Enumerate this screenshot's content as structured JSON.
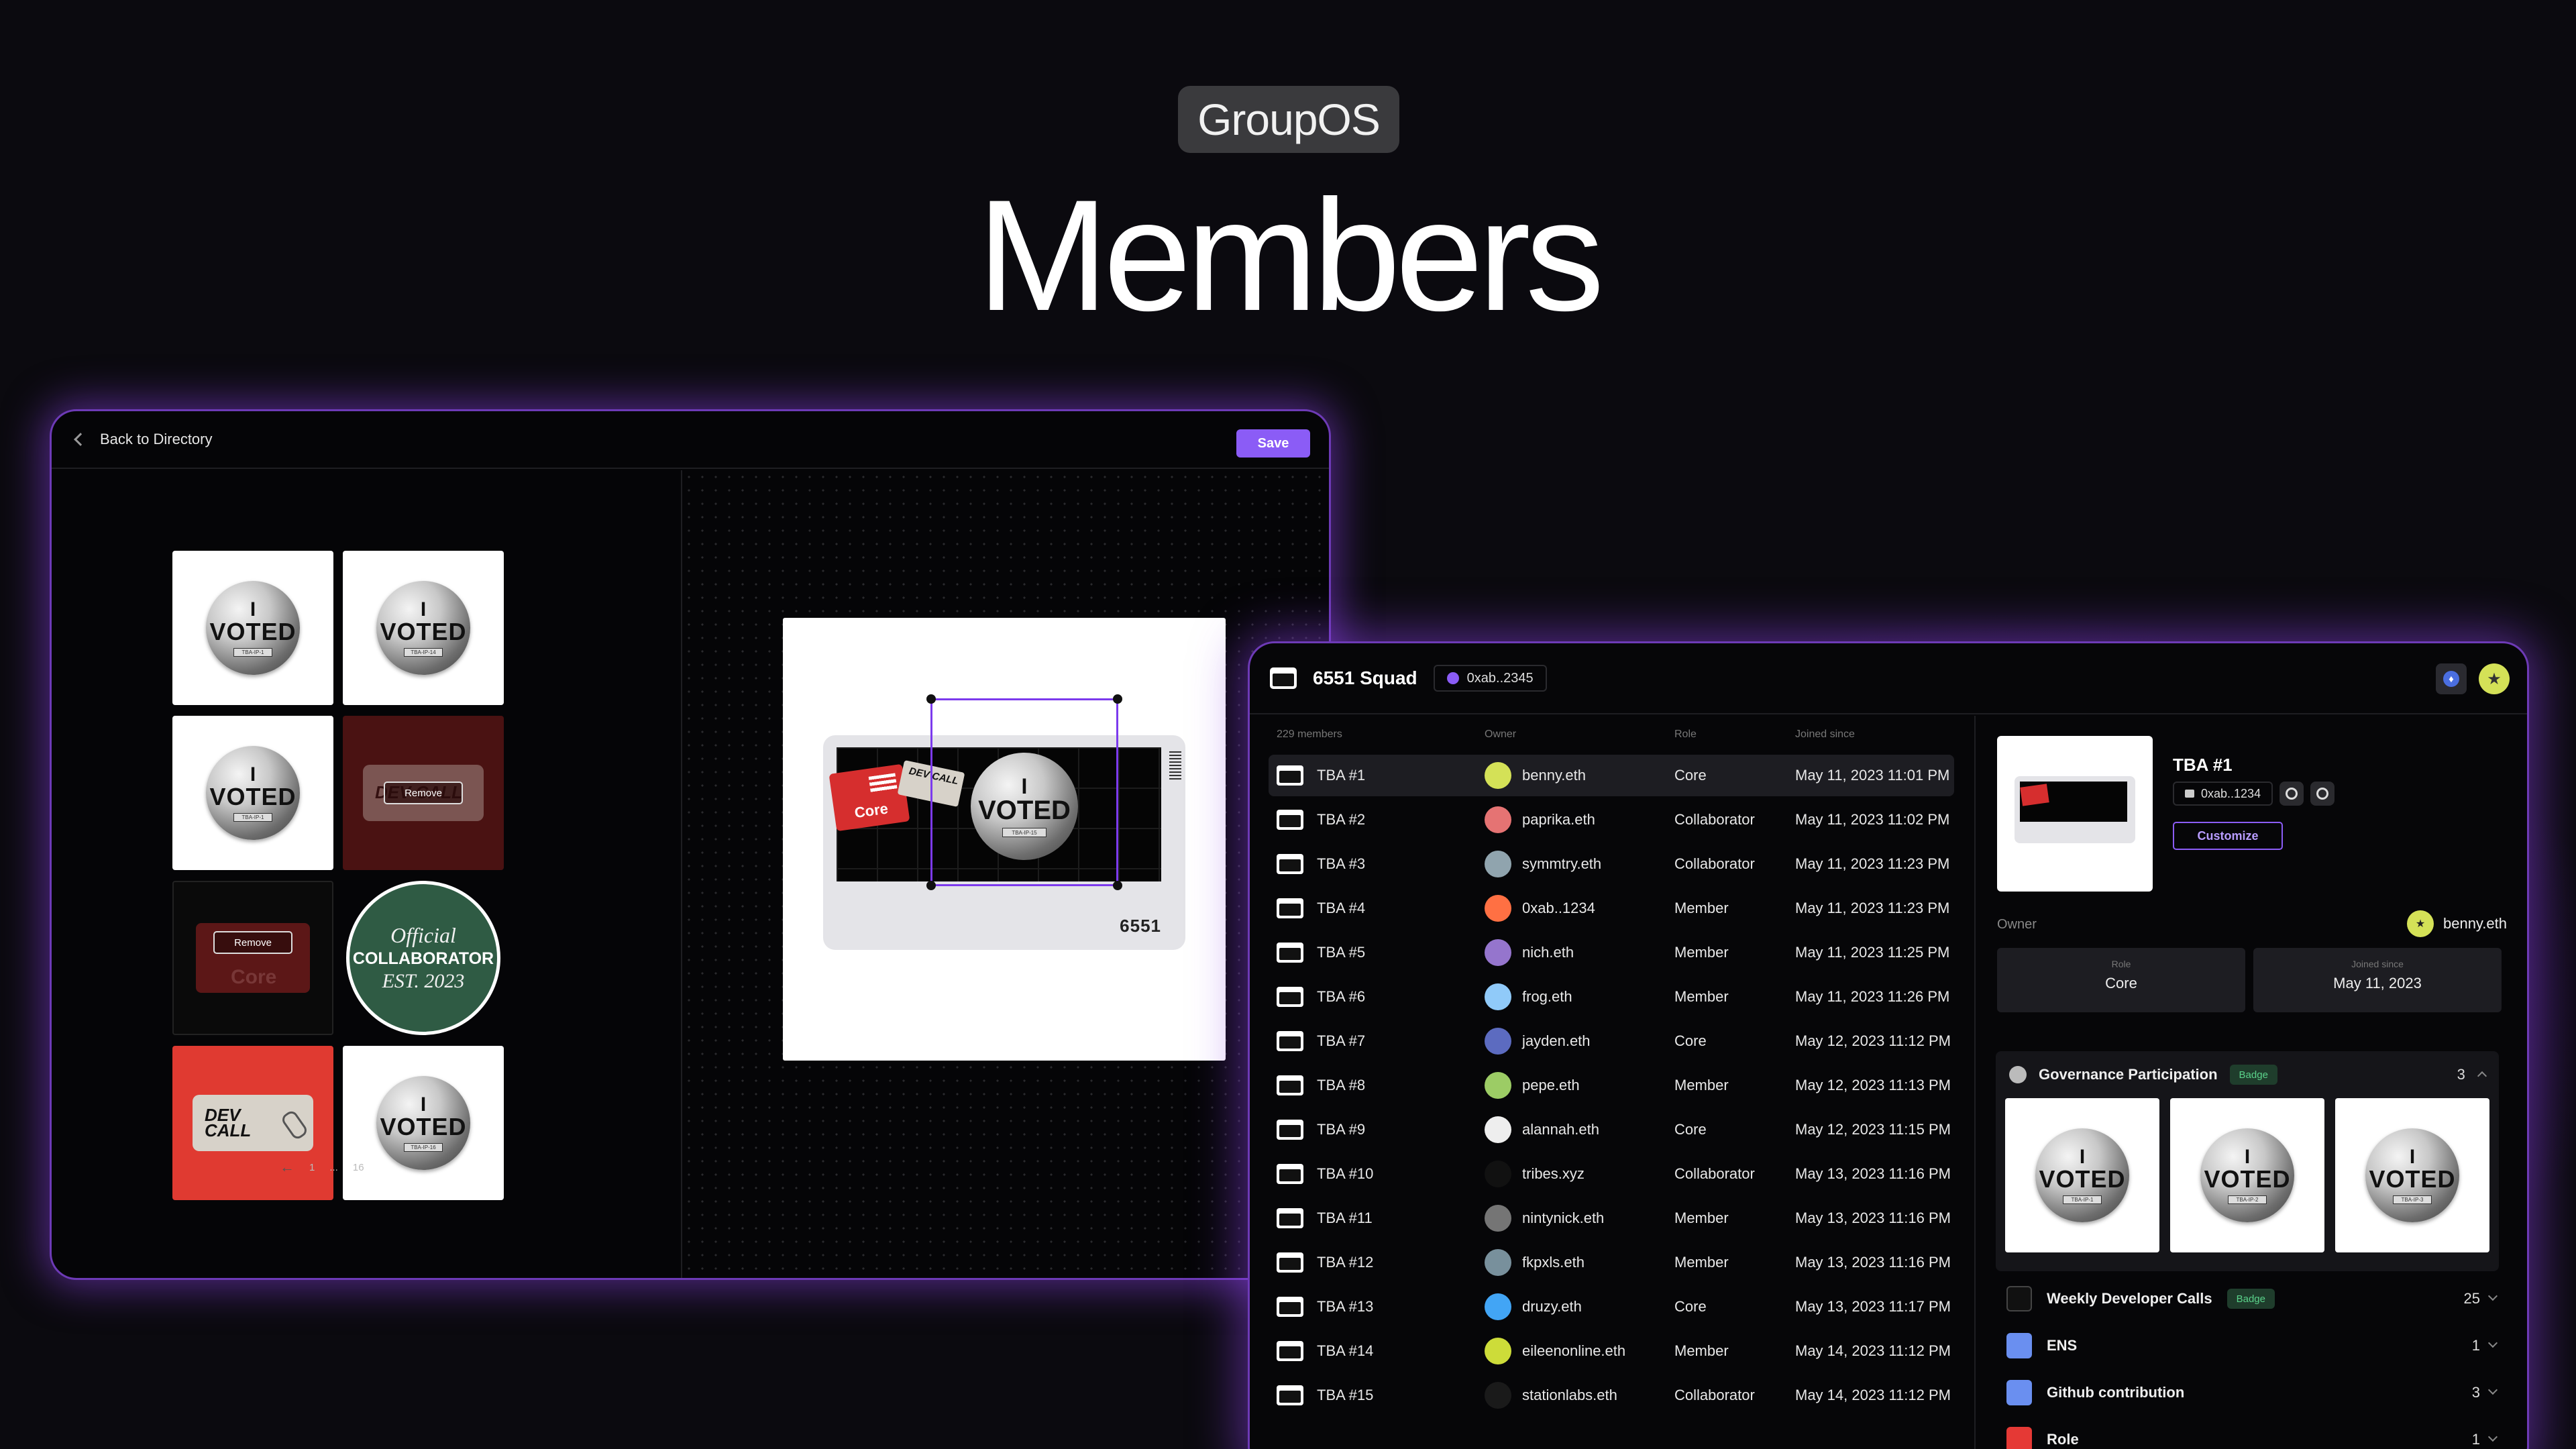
{
  "hero": {
    "brand": "GroupOS",
    "title": "Members"
  },
  "editor": {
    "back_label": "Back to Directory",
    "save_label": "Save",
    "remove_label": "Remove",
    "tiles": {
      "voted_i": "I",
      "voted_word": "VOTED",
      "tag1": "TBA-IP-1",
      "tag2": "TBA-IP-14",
      "tag3": "TBA-IP-1",
      "tag4": "TBA-IP-16",
      "dev_call": "DEV CALL",
      "core": "Core",
      "collab_official": "Official",
      "collab_word": "COLLABORATOR",
      "collab_est": "EST. 2023"
    },
    "pager": {
      "prev": "←",
      "page": "1",
      "ellipsis": "...",
      "last": "16",
      "next": "→"
    },
    "canvas": {
      "number": "6551",
      "core": "Core",
      "dev_call": "DEV CALL",
      "voted_i": "I",
      "voted_word": "VOTED",
      "tag": "TBA-IP-15"
    }
  },
  "squad": {
    "title": "6551 Squad",
    "address": "0xab..2345",
    "eth_symbol": "♦",
    "list": {
      "count_label": "229 members",
      "headers": {
        "owner": "Owner",
        "role": "Role",
        "joined": "Joined since"
      },
      "rows": [
        {
          "tba": "TBA #1",
          "owner": "benny.eth",
          "role": "Core",
          "joined": "May 11, 2023 11:01 PM",
          "color": "#d4e157"
        },
        {
          "tba": "TBA #2",
          "owner": "paprika.eth",
          "role": "Collaborator",
          "joined": "May 11, 2023 11:02 PM",
          "color": "#e57373"
        },
        {
          "tba": "TBA #3",
          "owner": "symmtry.eth",
          "role": "Collaborator",
          "joined": "May 11, 2023 11:23 PM",
          "color": "#90a4ae"
        },
        {
          "tba": "TBA #4",
          "owner": "0xab..1234",
          "role": "Member",
          "joined": "May 11, 2023 11:23 PM",
          "color": "#ff7043"
        },
        {
          "tba": "TBA #5",
          "owner": "nich.eth",
          "role": "Member",
          "joined": "May 11, 2023 11:25 PM",
          "color": "#9575cd"
        },
        {
          "tba": "TBA #6",
          "owner": "frog.eth",
          "role": "Member",
          "joined": "May 11, 2023 11:26 PM",
          "color": "#90caf9"
        },
        {
          "tba": "TBA #7",
          "owner": "jayden.eth",
          "role": "Core",
          "joined": "May 12, 2023 11:12 PM",
          "color": "#5c6bc0"
        },
        {
          "tba": "TBA #8",
          "owner": "pepe.eth",
          "role": "Member",
          "joined": "May 12, 2023 11:13 PM",
          "color": "#9ccc65"
        },
        {
          "tba": "TBA #9",
          "owner": "alannah.eth",
          "role": "Core",
          "joined": "May 12, 2023 11:15 PM",
          "color": "#eeeeee"
        },
        {
          "tba": "TBA #10",
          "owner": "tribes.xyz",
          "role": "Collaborator",
          "joined": "May 13, 2023 11:16 PM",
          "color": "#111111"
        },
        {
          "tba": "TBA #11",
          "owner": "nintynick.eth",
          "role": "Member",
          "joined": "May 13, 2023 11:16 PM",
          "color": "#757575"
        },
        {
          "tba": "TBA #12",
          "owner": "fkpxls.eth",
          "role": "Member",
          "joined": "May 13, 2023 11:16 PM",
          "color": "#78909c"
        },
        {
          "tba": "TBA #13",
          "owner": "druzy.eth",
          "role": "Core",
          "joined": "May 13, 2023 11:17 PM",
          "color": "#42a5f5"
        },
        {
          "tba": "TBA #14",
          "owner": "eileenonline.eth",
          "role": "Member",
          "joined": "May 14, 2023 11:12 PM",
          "color": "#cddc39"
        },
        {
          "tba": "TBA #15",
          "owner": "stationlabs.eth",
          "role": "Collaborator",
          "joined": "May 14, 2023 11:12 PM",
          "color": "#1a1a1a"
        }
      ]
    },
    "detail": {
      "tba": "TBA #1",
      "address": "0xab..1234",
      "customize_label": "Customize",
      "owner_label": "Owner",
      "owner": "benny.eth",
      "role_label": "Role",
      "role": "Core",
      "joined_label": "Joined since",
      "joined": "May 11, 2023",
      "gov": {
        "title": "Governance Participation",
        "badge": "Badge",
        "count": "3",
        "voted_i": "I",
        "voted_word": "VOTED",
        "tag1": "TBA-IP-1",
        "tag2": "TBA-IP-2",
        "tag3": "TBA-IP-3"
      },
      "items": [
        {
          "title": "Weekly Developer Calls",
          "badge": "Badge",
          "count": "25"
        },
        {
          "title": "ENS",
          "count": "1"
        },
        {
          "title": "Github contribution",
          "count": "3"
        },
        {
          "title": "Role",
          "count": "1"
        }
      ]
    }
  }
}
